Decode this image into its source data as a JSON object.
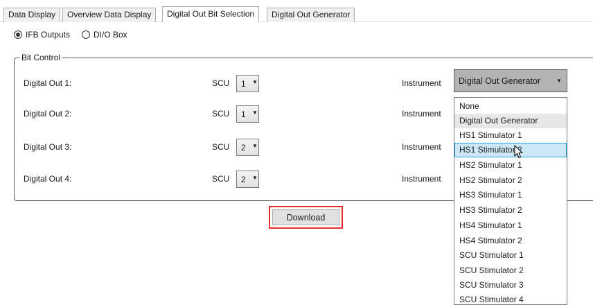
{
  "tabs": [
    {
      "label": "Data Display",
      "active": false
    },
    {
      "label": "Overview Data Display",
      "active": false
    },
    {
      "label": "Digital Out Bit Selection",
      "active": true
    },
    {
      "label": "Digital Out Generator",
      "active": false
    }
  ],
  "output_mode": {
    "options": [
      "IFB Outputs",
      "DI/O Box"
    ],
    "selected": "IFB Outputs"
  },
  "bit_control": {
    "title": "Bit Control",
    "scu_label": "SCU",
    "instrument_label": "Instrument",
    "rows": [
      {
        "label": "Digital Out 1:",
        "scu": "1",
        "instrument": "Digital Out Generator"
      },
      {
        "label": "Digital Out 2:",
        "scu": "1"
      },
      {
        "label": "Digital Out 3:",
        "scu": "2"
      },
      {
        "label": "Digital Out 4:",
        "scu": "2"
      }
    ]
  },
  "instrument_dropdown": {
    "options": [
      "None",
      "Digital Out Generator",
      "HS1 Stimulator 1",
      "HS1 Stimulator 2",
      "HS2 Stimulator 1",
      "HS2 Stimulator 2",
      "HS3 Stimulator 1",
      "HS3 Stimulator 2",
      "HS4 Stimulator 1",
      "HS4 Stimulator 2",
      "SCU Stimulator 1",
      "SCU Stimulator 2",
      "SCU Stimulator 3",
      "SCU Stimulator 4"
    ],
    "selected": "Digital Out Generator",
    "hovered": "HS1 Stimulator 2"
  },
  "actions": {
    "download_label": "Download"
  },
  "icons": {
    "dropdown_arrow": "chevron-down-icon",
    "cursor": "mouse-pointer-icon"
  },
  "colors": {
    "highlight_border": "#e52b2b",
    "hover_bg": "#cce8f7",
    "hover_border": "#26a0da"
  }
}
